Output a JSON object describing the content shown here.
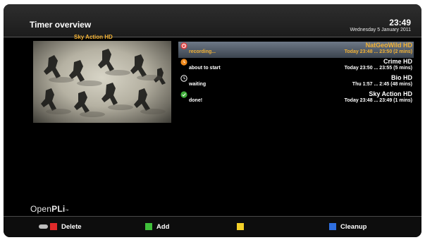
{
  "header": {
    "title": "Timer overview",
    "clock": "23:49",
    "date": "Wednesday 5 January 2011"
  },
  "preview": {
    "channel": "Sky Action HD"
  },
  "timers": [
    {
      "channel": "NatGeoWild HD",
      "status": "recording...",
      "time": "Today 23:48 ... 23:50 (2 mins)",
      "icon": "record-icon",
      "icon_color": "#e23232",
      "selected": true
    },
    {
      "channel": "Crime HD",
      "status": "about to start",
      "time": "Today 23:50 ... 23:55 (5 mins)",
      "icon": "about-to-start-icon",
      "icon_color": "#f08a1c",
      "selected": false
    },
    {
      "channel": "Bio HD",
      "status": "waiting",
      "time": "Thu 1:57 ... 2:45 (48 mins)",
      "icon": "clock-icon",
      "icon_color": "#ffffff",
      "selected": false
    },
    {
      "channel": "Sky Action HD",
      "status": "done!",
      "time": "Today 23:48 ... 23:49 (1 mins)",
      "icon": "done-icon",
      "icon_color": "#3fae3a",
      "selected": false
    }
  ],
  "logo": {
    "part1": "Open",
    "part2": "PLi"
  },
  "footer": {
    "delete_label": "Delete",
    "add_label": "Add",
    "yellow_label": "",
    "cleanup_label": "Cleanup"
  },
  "colors": {
    "accent": "#f2b133",
    "red": "#e02a2a",
    "green": "#3fbf3a",
    "yellow": "#f3d028",
    "blue": "#2f6fe0"
  }
}
